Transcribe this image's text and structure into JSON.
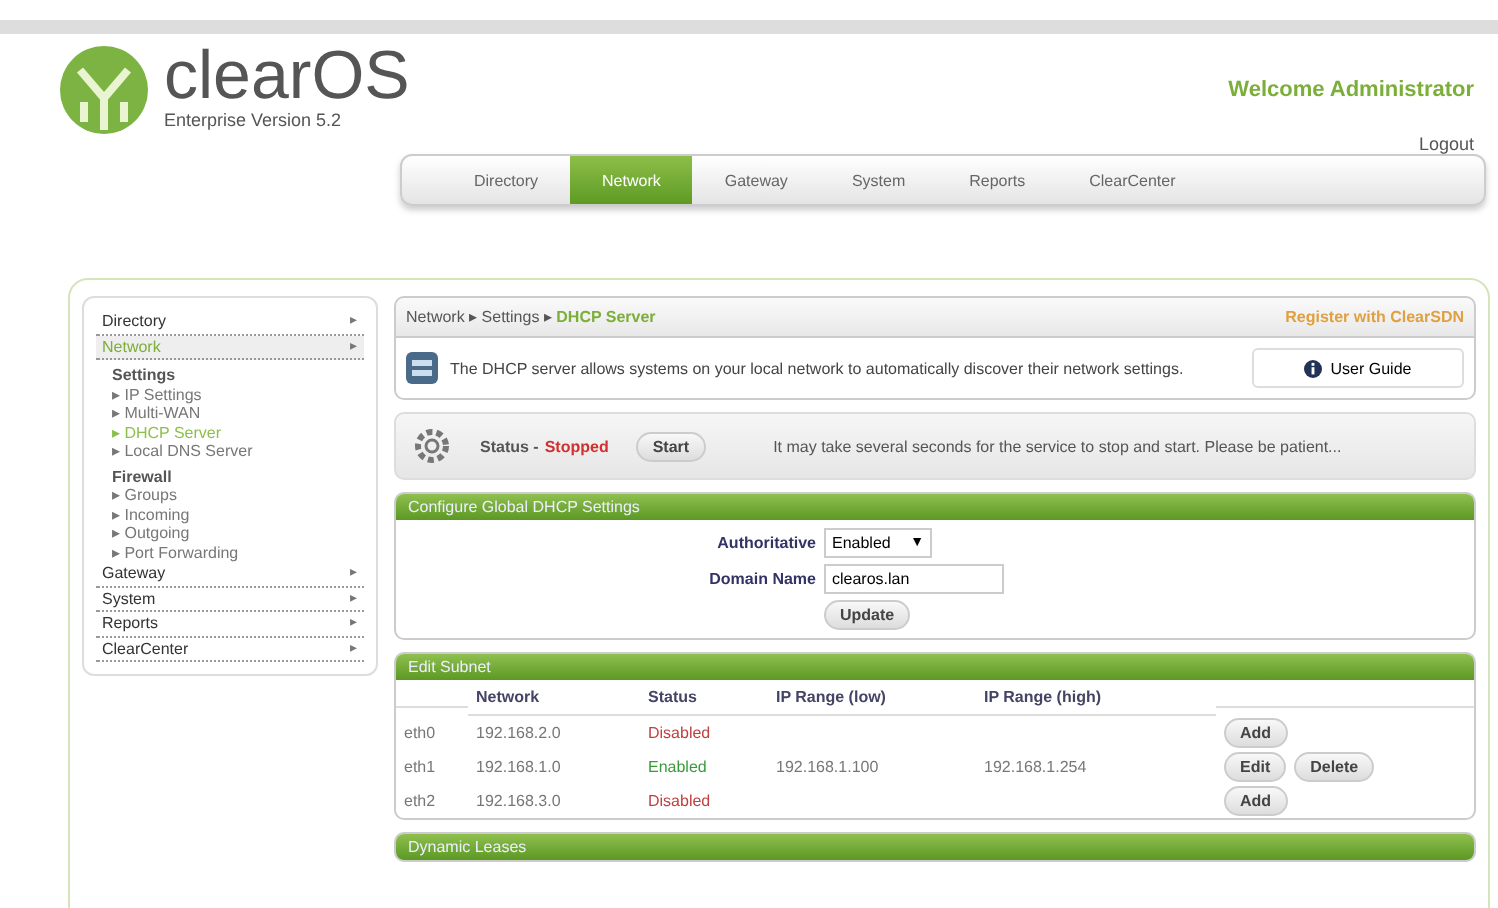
{
  "header": {
    "logo": "clearOS",
    "edition": "Enterprise Version 5.2",
    "welcome": "Welcome Administrator",
    "logout": "Logout"
  },
  "nav": [
    {
      "label": "Directory",
      "selected": false
    },
    {
      "label": "Network",
      "selected": true
    },
    {
      "label": "Gateway",
      "selected": false
    },
    {
      "label": "System",
      "selected": false
    },
    {
      "label": "Reports",
      "selected": false
    },
    {
      "label": "ClearCenter",
      "selected": false
    }
  ],
  "sidebar": {
    "items": [
      {
        "label": "Directory",
        "selected": false,
        "arrow": "▸"
      },
      {
        "label": "Network",
        "selected": true,
        "arrow": "▸",
        "groups": [
          {
            "label": "Settings",
            "bullet": "▸",
            "links": [
              {
                "label": "IP Settings",
                "selected": false
              },
              {
                "label": "Multi-WAN",
                "selected": false
              },
              {
                "label": "DHCP Server",
                "selected": true
              },
              {
                "label": "Local DNS Server",
                "selected": false
              }
            ]
          },
          {
            "label": "Firewall",
            "bullet": "▸",
            "links": [
              {
                "label": "Groups",
                "selected": false
              },
              {
                "label": "Incoming",
                "selected": false
              },
              {
                "label": "Outgoing",
                "selected": false
              },
              {
                "label": "Port Forwarding",
                "selected": false
              }
            ]
          }
        ]
      },
      {
        "label": "Gateway",
        "selected": false,
        "arrow": "▸"
      },
      {
        "label": "System",
        "selected": false,
        "arrow": "▸"
      },
      {
        "label": "Reports",
        "selected": false,
        "arrow": "▸"
      },
      {
        "label": "ClearCenter",
        "selected": false,
        "arrow": "▸"
      }
    ]
  },
  "breadcrumb": {
    "parts": [
      "Network",
      "Settings"
    ],
    "current": "DHCP Server",
    "separator": "▸",
    "register": "Register with ClearSDN"
  },
  "info": {
    "text": "The DHCP server allows systems on your local network to automatically discover their network settings.",
    "guide": "User Guide"
  },
  "status": {
    "label": "Status -",
    "value": "Stopped",
    "running": false,
    "button": "Start",
    "note": "It may take several seconds for the service to stop and start.  Please be patient..."
  },
  "config": {
    "title": "Configure Global DHCP Settings",
    "authoritative_label": "Authoritative",
    "authoritative": "Enabled",
    "dropdown_arrow": "▼",
    "domain_label": "Domain Name",
    "domain": "clearos.lan",
    "button": "Update"
  },
  "subnet": {
    "title": "Edit Subnet",
    "columns": [
      "Network",
      "Status",
      "IP Range (low)",
      "IP Range (high)"
    ],
    "rows": [
      {
        "iface": "eth0",
        "network": "192.168.2.0",
        "status": "Disabled",
        "enabled": false,
        "actions": [
          "Add"
        ]
      },
      {
        "iface": "eth1",
        "network": "192.168.1.0",
        "status": "Enabled",
        "enabled": true,
        "low": "192.168.1.100",
        "high": "192.168.1.254",
        "actions": [
          "Edit",
          "Delete"
        ]
      },
      {
        "iface": "eth2",
        "network": "192.168.3.0",
        "status": "Disabled",
        "enabled": false,
        "actions": [
          "Add"
        ]
      }
    ]
  },
  "leases": {
    "title": "Dynamic Leases"
  }
}
